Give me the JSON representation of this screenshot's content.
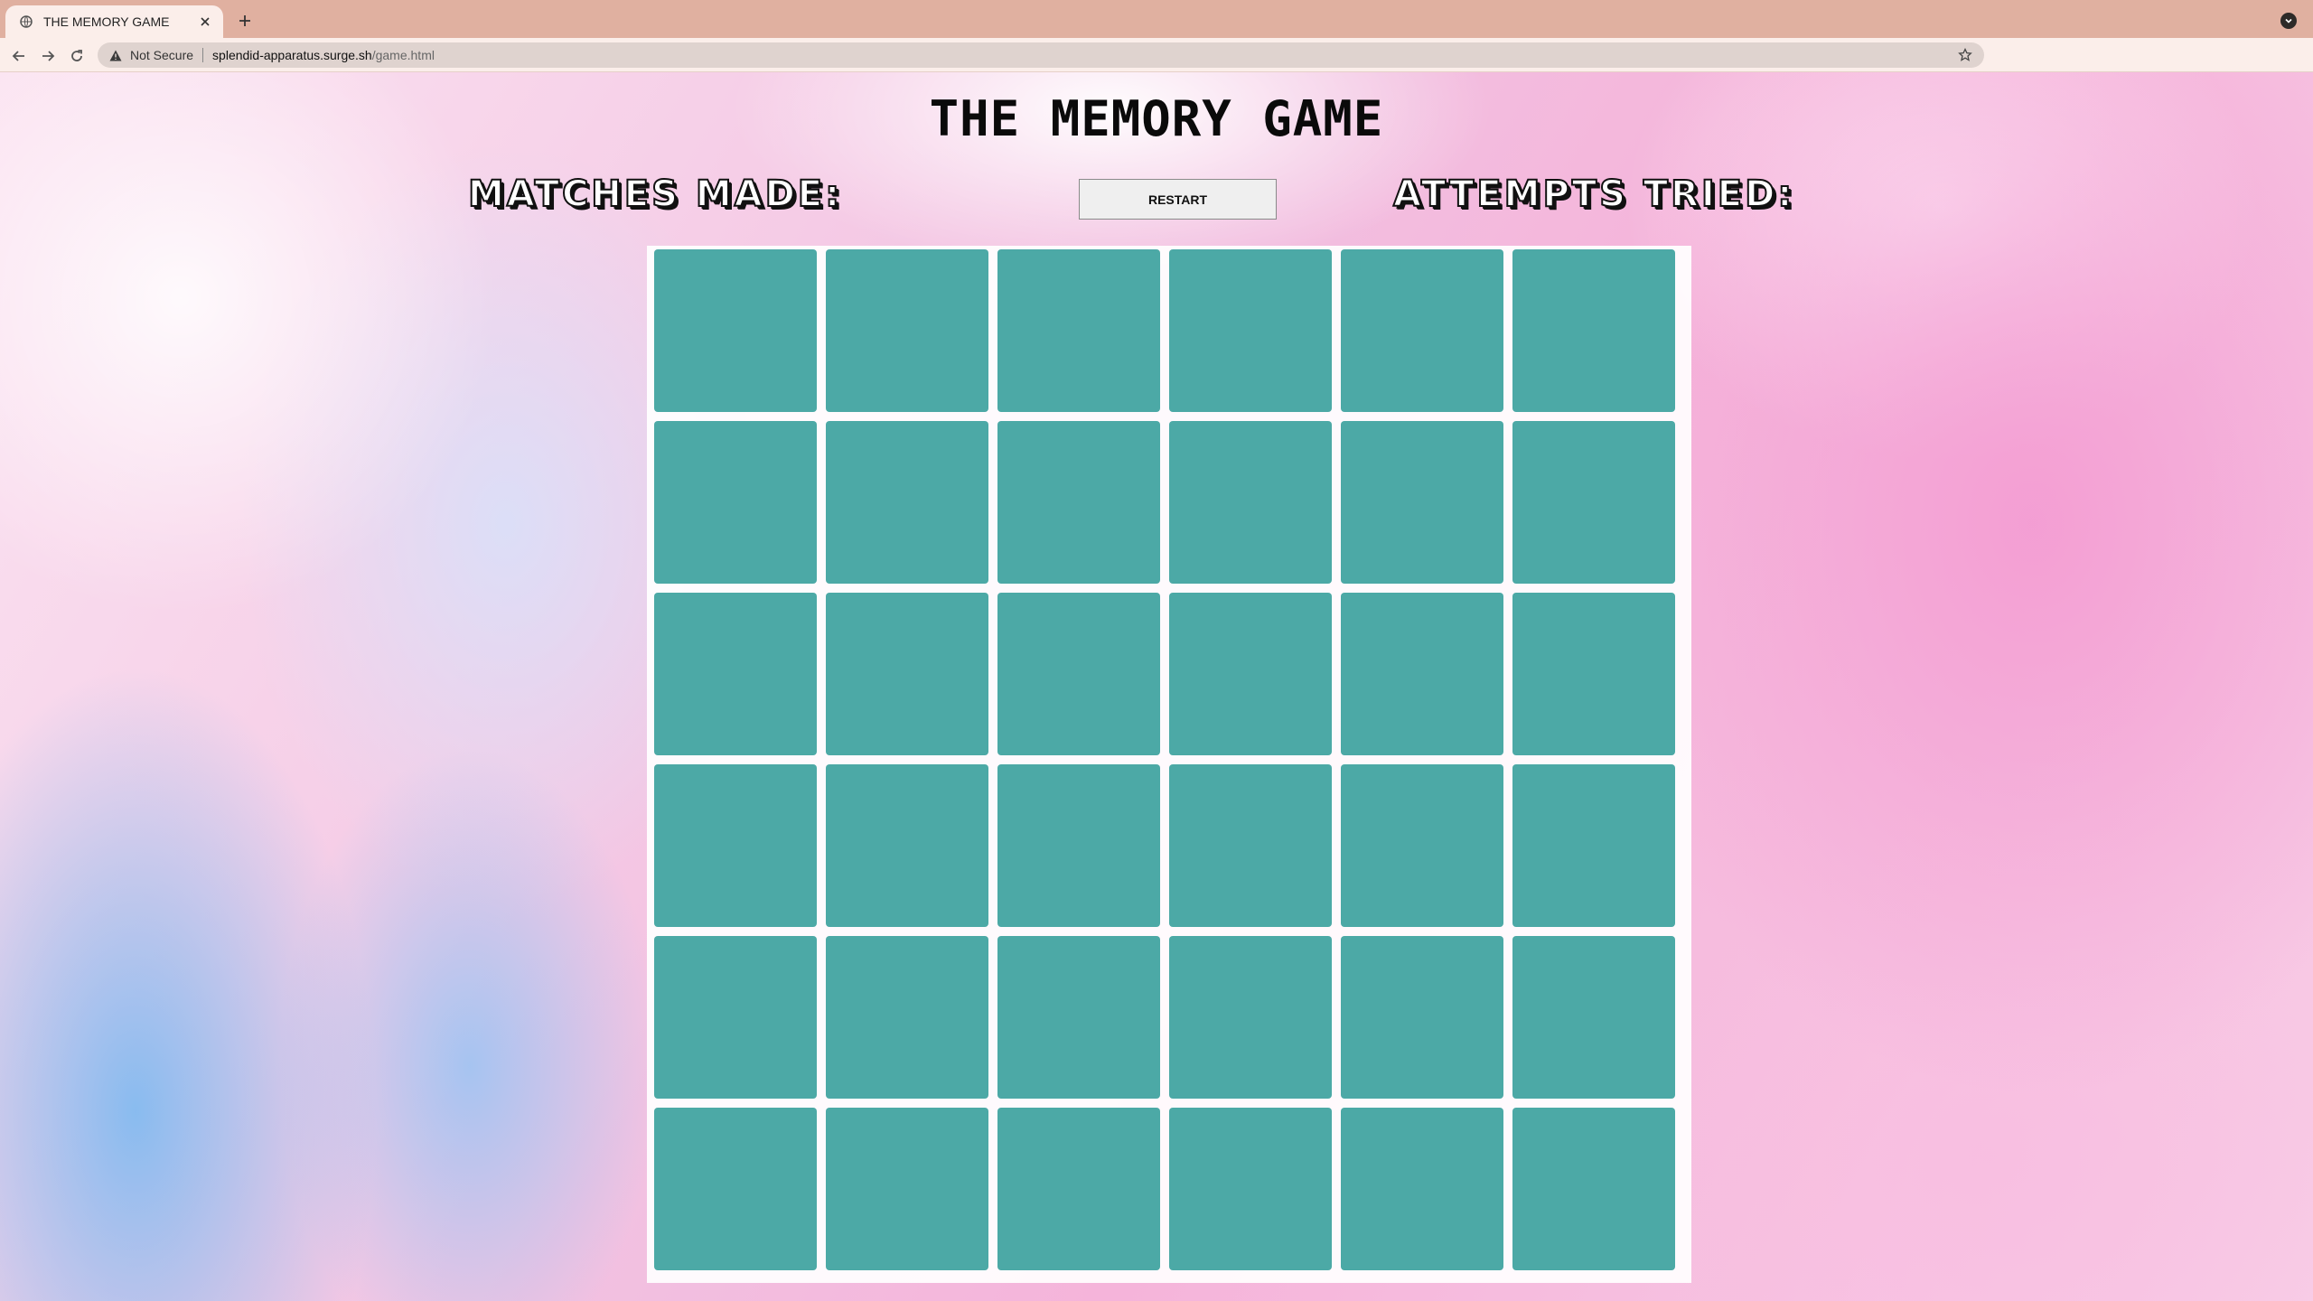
{
  "browser": {
    "tab_title": "THE MEMORY GAME",
    "security_label": "Not Secure",
    "url_host": "splendid-apparatus.surge.sh",
    "url_path": "/game.html"
  },
  "page": {
    "title": "THE MEMORY GAME",
    "matches_label": "MATCHES MADE:",
    "attempts_label": "ATTEMPTS TRIED:",
    "restart_label": "RESTART"
  },
  "board": {
    "rows": 6,
    "columns": 6,
    "card_color": "#4ca9a6",
    "card_state": "face-down"
  },
  "colors": {
    "card": "#4ca9a6",
    "tab_bar": "#e0b0a0",
    "toolbar": "#fbeeea"
  }
}
